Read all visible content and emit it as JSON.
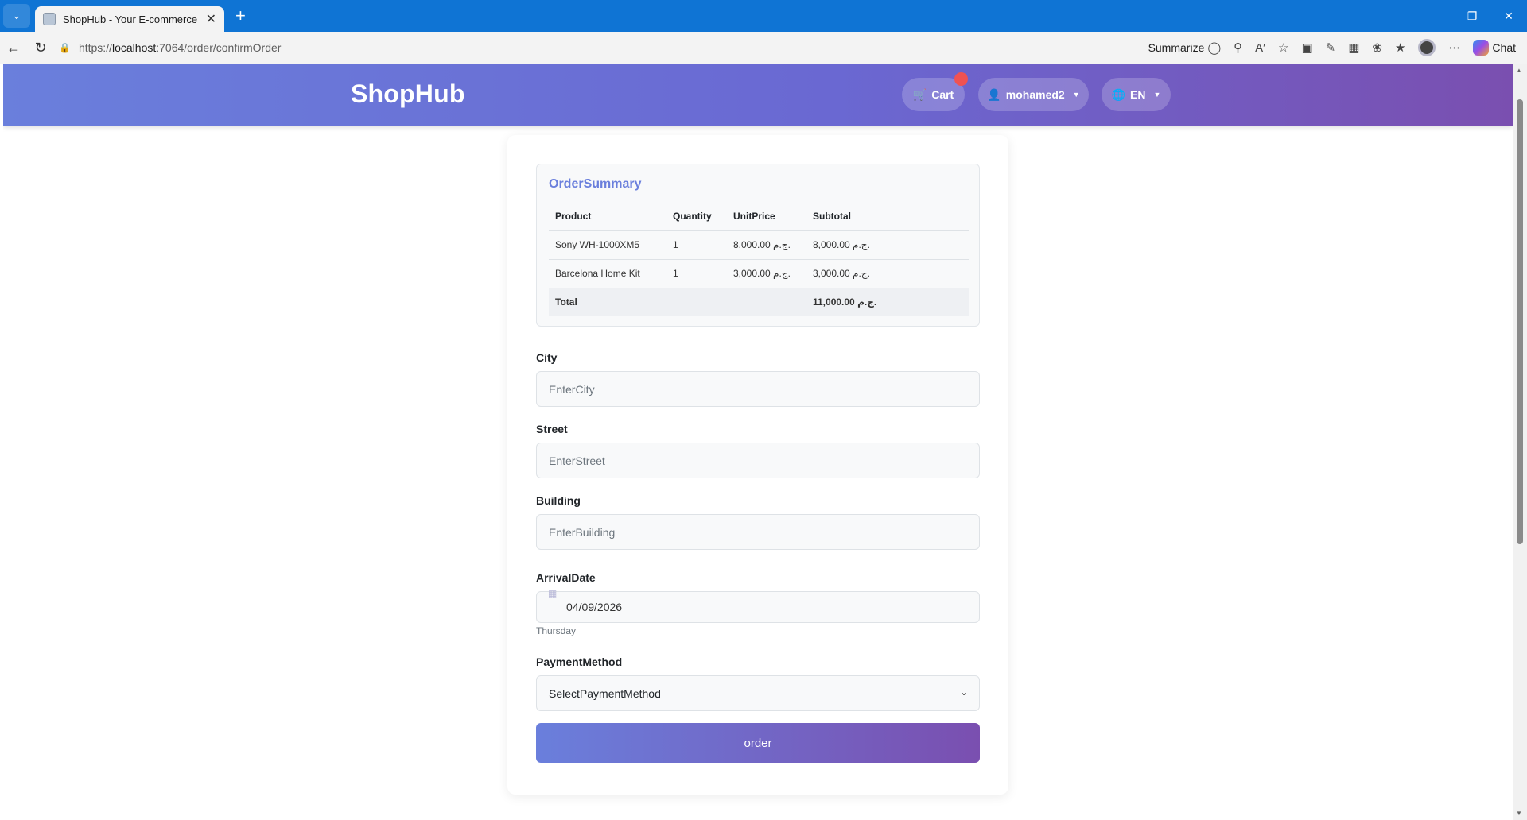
{
  "browser": {
    "tab_title": "ShopHub - Your E-commerce",
    "url_prefix": "https://",
    "url_host": "localhost",
    "url_path": ":7064/order/confirmOrder",
    "summarize_label": "Summarize",
    "chat_label": "Chat"
  },
  "header": {
    "brand": "ShopHub",
    "cart_label": "Cart",
    "user_label": "mohamed2",
    "lang_label": "EN"
  },
  "summary": {
    "title": "OrderSummary",
    "columns": [
      "Product",
      "Quantity",
      "UnitPrice",
      "Subtotal"
    ],
    "rows": [
      {
        "product": "Sony WH-1000XM5",
        "quantity": "1",
        "unit_price": "8,000.00 ج.م.",
        "subtotal": "8,000.00 ج.م."
      },
      {
        "product": "Barcelona Home Kit",
        "quantity": "1",
        "unit_price": "3,000.00 ج.م.",
        "subtotal": "3,000.00 ج.م."
      }
    ],
    "total_label": "Total",
    "total_value": "11,000.00 ج.م."
  },
  "form": {
    "city_label": "City",
    "city_placeholder": "EnterCity",
    "street_label": "Street",
    "street_placeholder": "EnterStreet",
    "building_label": "Building",
    "building_placeholder": "EnterBuilding",
    "date_label": "ArrivalDate",
    "date_value": "04/09/2026",
    "date_hint": "Thursday",
    "payment_label": "PaymentMethod",
    "payment_selected": "SelectPaymentMethod",
    "submit_label": "order"
  }
}
